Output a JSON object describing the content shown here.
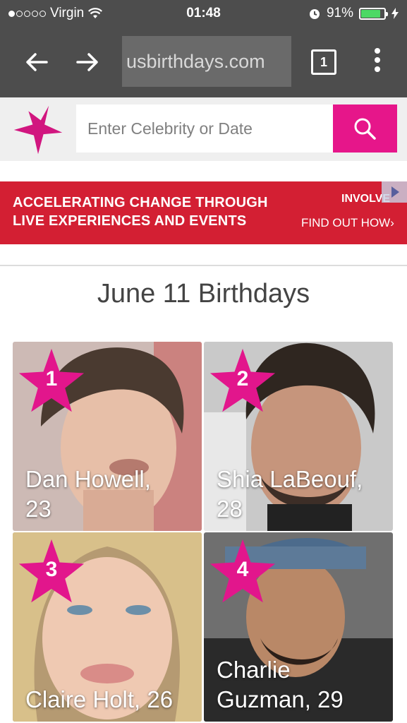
{
  "status_bar": {
    "carrier": "Virgin",
    "time": "01:48",
    "battery": "91%",
    "battery_level": 0.91
  },
  "browser": {
    "url": "usbirthdays.com",
    "tab_count": "1"
  },
  "site": {
    "search_placeholder": "Enter Celebrity or Date",
    "accent_color": "#e6168a"
  },
  "ad": {
    "line1": "ACCELERATING CHANGE THROUGH",
    "line2": "LIVE EXPERIENCES AND EVENTS",
    "brand": "INVOLVE",
    "cta": "FIND OUT HOW›",
    "color": "#d31f33"
  },
  "page": {
    "title": "June 11 Birthdays",
    "celebrities": [
      {
        "rank": "1",
        "name_line1": "Dan Howell,",
        "name_line2": "23"
      },
      {
        "rank": "2",
        "name_line1": "Shia LaBeouf,",
        "name_line2": "28"
      },
      {
        "rank": "3",
        "name_line1": "",
        "name_line2": "Claire Holt, 26"
      },
      {
        "rank": "4",
        "name_line1": "Charlie",
        "name_line2": "Guzman, 29"
      }
    ]
  }
}
